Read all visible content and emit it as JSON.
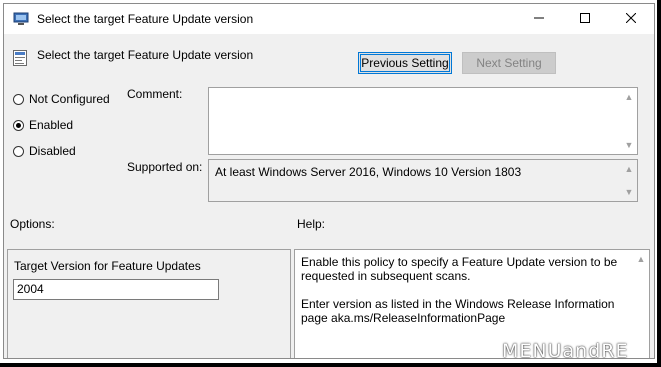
{
  "window": {
    "title": "Select the target Feature Update version"
  },
  "header": {
    "policy_name": "Select the target Feature Update version",
    "prev_button": "Previous Setting",
    "next_button": "Next Setting"
  },
  "state": {
    "options": [
      {
        "label": "Not Configured",
        "checked": false
      },
      {
        "label": "Enabled",
        "checked": true
      },
      {
        "label": "Disabled",
        "checked": false
      }
    ]
  },
  "comment": {
    "label": "Comment:",
    "value": ""
  },
  "supported": {
    "label": "Supported on:",
    "value": "At least Windows Server 2016, Windows 10 Version 1803"
  },
  "options_section": {
    "heading": "Options:",
    "field_label": "Target Version for Feature Updates",
    "field_value": "2004"
  },
  "help_section": {
    "heading": "Help:",
    "paragraph1": "Enable this policy to specify a Feature Update version to be requested in subsequent scans.",
    "paragraph2": "Enter version as listed in the Windows Release Information page aka.ms/ReleaseInformationPage"
  },
  "watermark": "MENUandRE"
}
